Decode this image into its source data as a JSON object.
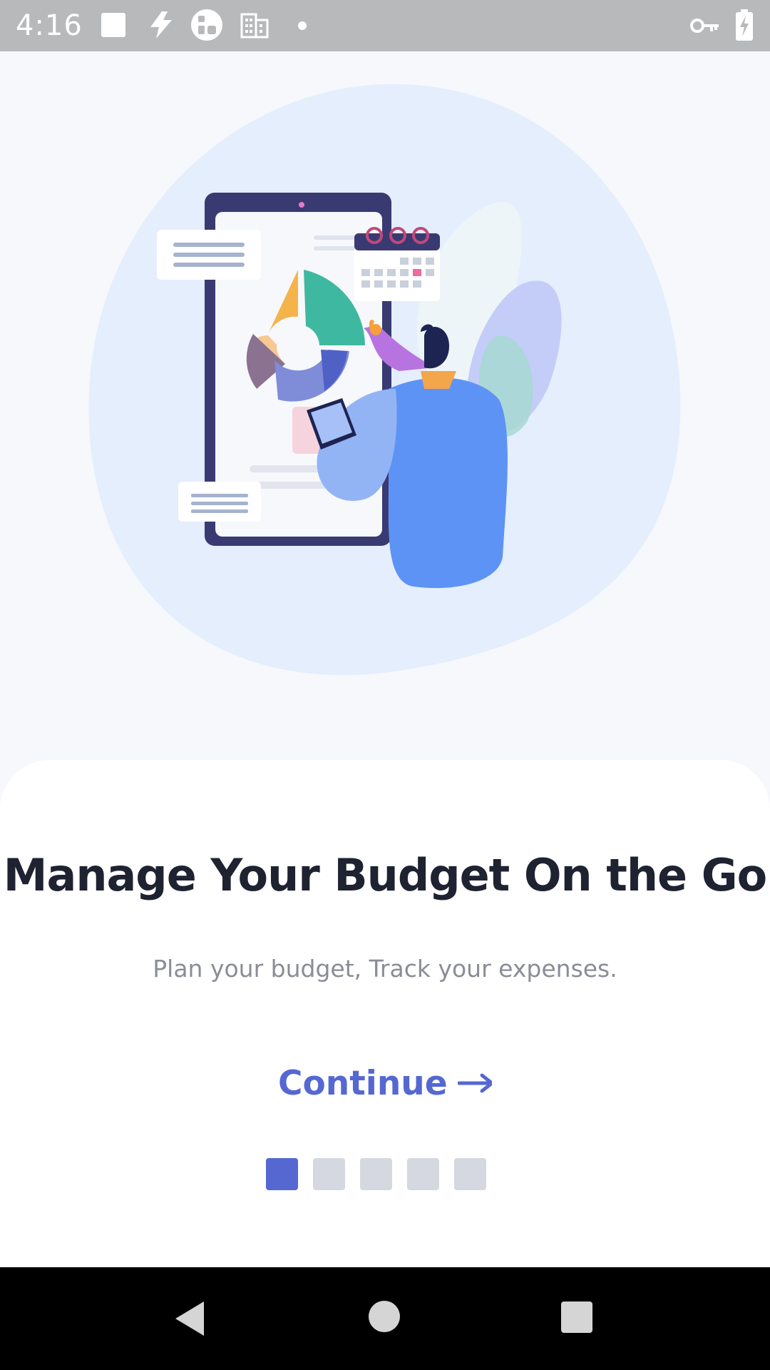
{
  "status_bar": {
    "time": "4:16",
    "left_icons": [
      "square-notification-icon",
      "bolt-icon",
      "app-circle-icon",
      "building-icon",
      "dot-icon"
    ],
    "right_icons": [
      "key-icon",
      "battery-charging-icon"
    ]
  },
  "onboarding": {
    "title": "Manage Your Budget On the Go",
    "subtitle": "Plan your budget, Track your expenses.",
    "continue_label": "Continue",
    "continue_icon": "arrow-right-icon",
    "pages_total": 5,
    "current_page": 1
  },
  "colors": {
    "accent": "#5568d2",
    "inactive_dot": "#d6d8e1",
    "title": "#1f2230",
    "subtitle": "#8a8d96",
    "background": "#f6f8fc",
    "status_bar": "#b8b9bb"
  },
  "nav_bar": {
    "buttons": [
      "back-icon",
      "home-icon",
      "recents-icon"
    ]
  }
}
